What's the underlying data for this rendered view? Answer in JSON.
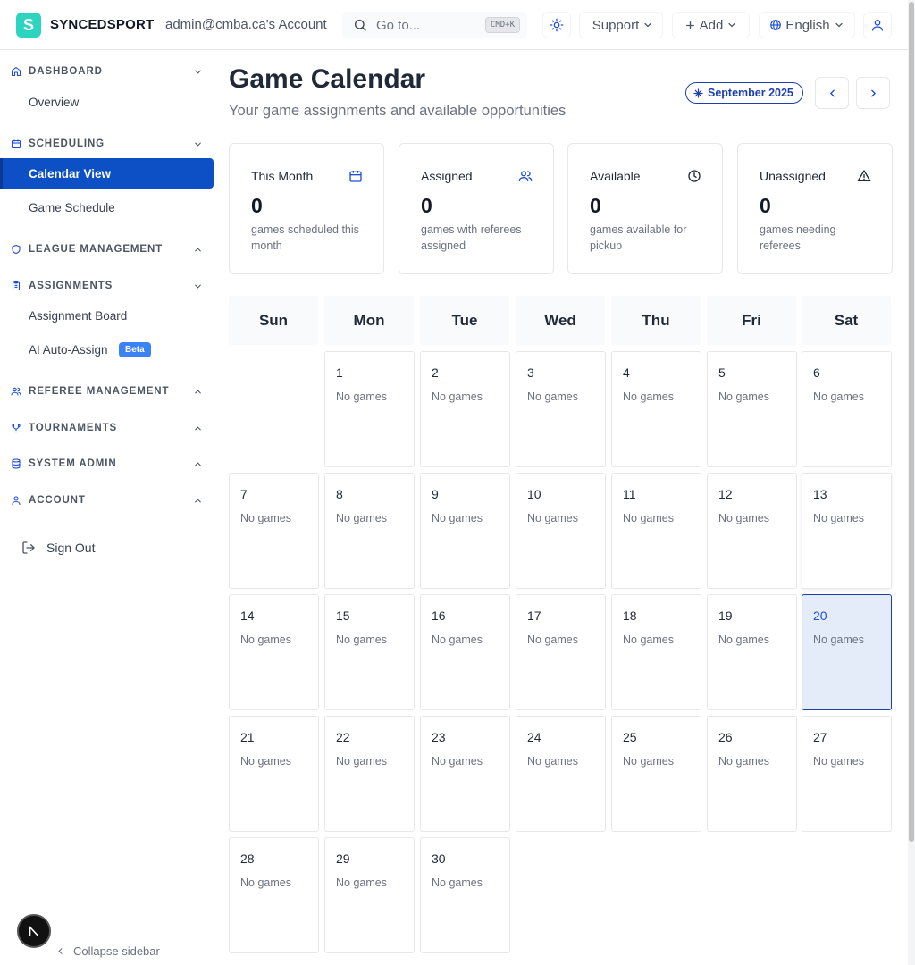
{
  "header": {
    "brand": "SYNCEDSPORT",
    "logo_letter": "S",
    "account": "admin@cmba.ca's Account",
    "search_placeholder": "Go to...",
    "search_shortcut": "CMD+K",
    "support_label": "Support",
    "add_label": "Add",
    "language_label": "English"
  },
  "sidebar": {
    "sections": [
      {
        "label": "DASHBOARD",
        "icon": "home-icon",
        "expanded": true,
        "items": [
          {
            "label": "Overview"
          }
        ]
      },
      {
        "label": "SCHEDULING",
        "icon": "calendar-icon",
        "expanded": true,
        "items": [
          {
            "label": "Calendar View",
            "active": true
          },
          {
            "label": "Game Schedule"
          }
        ]
      },
      {
        "label": "LEAGUE MANAGEMENT",
        "icon": "shield-icon",
        "expanded": false,
        "items": []
      },
      {
        "label": "ASSIGNMENTS",
        "icon": "clipboard-icon",
        "expanded": true,
        "items": [
          {
            "label": "Assignment Board"
          },
          {
            "label": "AI Auto-Assign",
            "badge": "Beta"
          }
        ]
      },
      {
        "label": "REFEREE MANAGEMENT",
        "icon": "users-icon",
        "expanded": false,
        "items": []
      },
      {
        "label": "TOURNAMENTS",
        "icon": "trophy-icon",
        "expanded": false,
        "items": []
      },
      {
        "label": "SYSTEM ADMIN",
        "icon": "database-icon",
        "expanded": false,
        "items": []
      },
      {
        "label": "ACCOUNT",
        "icon": "user-icon",
        "expanded": false,
        "items": []
      }
    ],
    "sign_out": "Sign Out",
    "collapse": "Collapse sidebar"
  },
  "page": {
    "title": "Game Calendar",
    "subtitle": "Your game assignments and available opportunities",
    "month": "September 2025"
  },
  "stats": [
    {
      "label": "This Month",
      "value": "0",
      "desc": "games scheduled this month",
      "icon": "calendar-icon"
    },
    {
      "label": "Assigned",
      "value": "0",
      "desc": "games with referees assigned",
      "icon": "users-icon"
    },
    {
      "label": "Available",
      "value": "0",
      "desc": "games available for pickup",
      "icon": "clock-icon"
    },
    {
      "label": "Unassigned",
      "value": "0",
      "desc": "games needing referees",
      "icon": "alert-triangle-icon"
    }
  ],
  "calendar": {
    "weekdays": [
      "Sun",
      "Mon",
      "Tue",
      "Wed",
      "Thu",
      "Fri",
      "Sat"
    ],
    "first_weekday_index": 1,
    "days_in_month": 30,
    "today": 20,
    "empty_text": "No games"
  },
  "colors": {
    "brand": "#2dd4bf",
    "active_nav": "#0d4fc4",
    "accent": "#1e40af",
    "today_bg": "#e5ecf9"
  }
}
